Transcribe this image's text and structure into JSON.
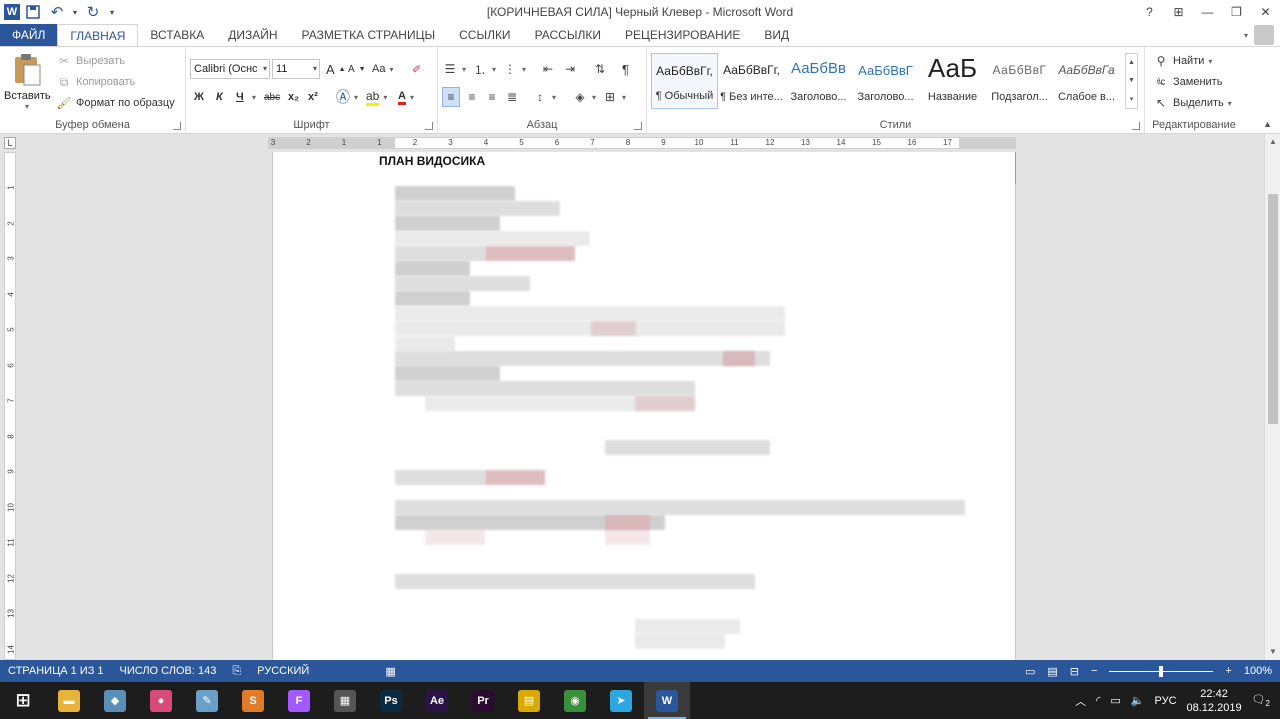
{
  "window": {
    "title": "[КОРИЧНЕВАЯ СИЛА] Черный Клевер - Microsoft Word",
    "help": "?",
    "controls": {
      "ribbon_display": "⊞",
      "minimize": "—",
      "maximize": "❐",
      "close": "✕"
    }
  },
  "qat": {
    "word_icon": "W",
    "save_icon": "save-icon",
    "undo_icon": "undo-icon",
    "redo_icon": "redo-icon",
    "customize": "▾"
  },
  "tabs": [
    {
      "label": "ФАЙЛ"
    },
    {
      "label": "ГЛАВНАЯ"
    },
    {
      "label": "ВСТАВКА"
    },
    {
      "label": "ДИЗАЙН"
    },
    {
      "label": "РАЗМЕТКА СТРАНИЦЫ"
    },
    {
      "label": "ССЫЛКИ"
    },
    {
      "label": "РАССЫЛКИ"
    },
    {
      "label": "РЕЦЕНЗИРОВАНИЕ"
    },
    {
      "label": "ВИД"
    }
  ],
  "clipboard": {
    "paste": "Вставить",
    "cut": "Вырезать",
    "copy": "Копировать",
    "format_painter": "Формат по образцу",
    "label": "Буфер обмена"
  },
  "font": {
    "name": "Calibri (Оснс",
    "size": "11",
    "bold": "Ж",
    "italic": "К",
    "underline": "Ч",
    "strike": "abc",
    "subscript": "x₂",
    "superscript": "x²",
    "grow": "A",
    "shrink": "A",
    "case": "Aa",
    "label": "Шрифт"
  },
  "paragraph": {
    "label": "Абзац",
    "pilcrow": "¶"
  },
  "styles": {
    "label": "Стили",
    "items": [
      {
        "sample": "АаБбВвГг,",
        "name": "¶ Обычный"
      },
      {
        "sample": "АаБбВвГг,",
        "name": "¶ Без инте..."
      },
      {
        "sample": "АаБбВв",
        "name": "Заголово..."
      },
      {
        "sample": "АаБбВвГ",
        "name": "Заголово..."
      },
      {
        "sample": "АаБ",
        "name": "Название"
      },
      {
        "sample": "АаБбВвГ",
        "name": "Подзагол..."
      },
      {
        "sample": "АаБбВвГа",
        "name": "Слабое в..."
      }
    ]
  },
  "editing": {
    "find": "Найти",
    "replace": "Заменить",
    "select": "Выделить",
    "label": "Редактирование"
  },
  "ruler": {
    "corner": "L",
    "ticks": [
      "3",
      "2",
      "1",
      "1",
      "2",
      "3",
      "4",
      "5",
      "6",
      "7",
      "8",
      "9",
      "10",
      "11",
      "12",
      "13",
      "14",
      "15",
      "16",
      "17"
    ]
  },
  "vruler": {
    "ticks": [
      "1",
      "2",
      "3",
      "4",
      "5",
      "6",
      "7",
      "8",
      "9",
      "10",
      "11",
      "12",
      "13",
      "14"
    ]
  },
  "document": {
    "heading": "ПЛАН ВИДОСИКА"
  },
  "status": {
    "page": "СТРАНИЦА 1 ИЗ 1",
    "words": "ЧИСЛО СЛОВ: 143",
    "language": "РУССКИЙ",
    "zoom": "100%"
  },
  "taskbar": {
    "apps": [
      {
        "name": "start",
        "glyph": "⊞",
        "color": "#1d1d1d"
      },
      {
        "name": "file-explorer",
        "glyph": "▬",
        "color": "#e8b339"
      },
      {
        "name": "app-2",
        "glyph": "◆",
        "color": "#5a8fb8"
      },
      {
        "name": "app-3",
        "glyph": "●",
        "color": "#d94a7a"
      },
      {
        "name": "app-4",
        "glyph": "✎",
        "color": "#6aa0c8"
      },
      {
        "name": "sublime",
        "glyph": "S",
        "color": "#e07b2a"
      },
      {
        "name": "figma",
        "glyph": "F",
        "color": "#a259ff"
      },
      {
        "name": "calculator",
        "glyph": "▦",
        "color": "#555555"
      },
      {
        "name": "photoshop",
        "glyph": "Ps",
        "color": "#0b2a44"
      },
      {
        "name": "after-effects",
        "glyph": "Ae",
        "color": "#2a1346"
      },
      {
        "name": "premiere",
        "glyph": "Pr",
        "color": "#2a0d2e"
      },
      {
        "name": "app-11",
        "glyph": "▤",
        "color": "#d8a900"
      },
      {
        "name": "chrome",
        "glyph": "◉",
        "color": "#3a8f3a"
      },
      {
        "name": "telegram",
        "glyph": "➤",
        "color": "#2ea6df"
      },
      {
        "name": "word",
        "glyph": "W",
        "color": "#2b579a"
      }
    ],
    "tray": {
      "language": "РУС",
      "time": "22:42",
      "date": "08.12.2019",
      "notifications": "2"
    }
  }
}
